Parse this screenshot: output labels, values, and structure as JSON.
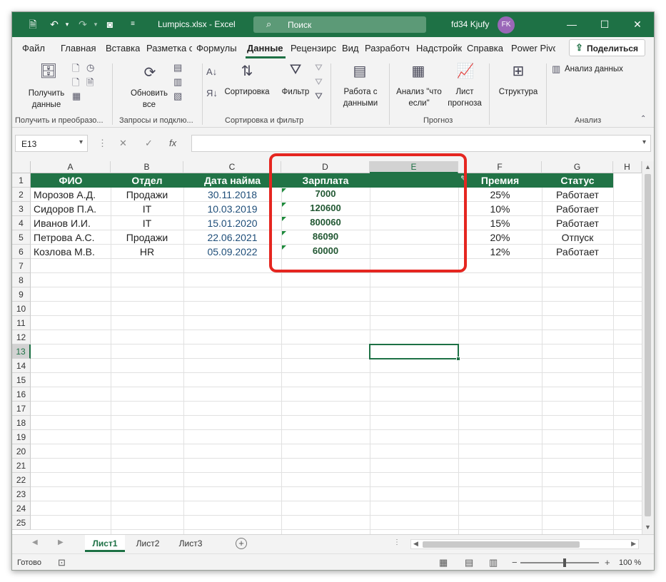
{
  "titlebar": {
    "filename": "Lumpics.xlsx",
    "separator": "-",
    "app": "Excel",
    "search_placeholder": "Поиск",
    "user_name": "fd34 Kjufy",
    "avatar_initials": "FK",
    "accent_color": "#1e7145"
  },
  "tabs": [
    "Файл",
    "Главная",
    "Вставка",
    "Разметка с",
    "Формулы",
    "Данные",
    "Рецензирс",
    "Вид",
    "Разработч",
    "Надстройк",
    "Справка",
    "Power Pivo"
  ],
  "active_tab": "Данные",
  "share_label": "Поделиться",
  "ribbon": {
    "get_data": "Получить данные",
    "refresh_all": "Обновить все",
    "sort": "Сортировка",
    "filter": "Фильтр",
    "data_tools": "Работа с данными",
    "what_if": "Анализ \"что если\"",
    "forecast_sheet": "Лист прогноза",
    "outline": "Структура",
    "data_analysis": "Анализ данных",
    "group_get_transform": "Получить и преобразо...",
    "group_queries": "Запросы и подклю...",
    "group_sort_filter": "Сортировка и фильтр",
    "group_forecast": "Прогноз",
    "group_analysis": "Анализ"
  },
  "formula_bar": {
    "name_box": "E13",
    "fx": "fx",
    "value": ""
  },
  "columns": [
    "A",
    "B",
    "C",
    "D",
    "E",
    "F",
    "G",
    "H"
  ],
  "selected_column": "E",
  "row_numbers": [
    "1",
    "2",
    "3",
    "4",
    "5",
    "6",
    "7",
    "8",
    "9",
    "10",
    "11",
    "12",
    "13",
    "14",
    "15",
    "16",
    "17",
    "18",
    "19",
    "20",
    "21",
    "22",
    "23",
    "24",
    "25"
  ],
  "selected_row": "13",
  "table": {
    "headers": {
      "fio": "ФИО",
      "dept": "Отдел",
      "hire_date": "Дата найма",
      "salary": "Зарплата",
      "bonus": "Премия",
      "status": "Статус"
    },
    "rows": [
      {
        "fio": "Морозов А.Д.",
        "dept": "Продажи",
        "hire_date": "30.11.2018",
        "salary": "7000",
        "bonus": "25%",
        "status": "Работает"
      },
      {
        "fio": "Сидоров П.А.",
        "dept": "IT",
        "hire_date": "10.03.2019",
        "salary": "120600",
        "bonus": "10%",
        "status": "Работает"
      },
      {
        "fio": "Иванов И.И.",
        "dept": "IT",
        "hire_date": "15.01.2020",
        "salary": "800060",
        "bonus": "15%",
        "status": "Работает"
      },
      {
        "fio": "Петрова А.С.",
        "dept": "Продажи",
        "hire_date": "22.06.2021",
        "salary": "86090",
        "bonus": "20%",
        "status": "Отпуск"
      },
      {
        "fio": "Козлова М.В.",
        "dept": "HR",
        "hire_date": "05.09.2022",
        "salary": "60000",
        "bonus": "12%",
        "status": "Работает"
      }
    ]
  },
  "sheets": [
    "Лист1",
    "Лист2",
    "Лист3"
  ],
  "active_sheet": "Лист1",
  "status": {
    "ready": "Готово",
    "zoom": "100 %"
  }
}
